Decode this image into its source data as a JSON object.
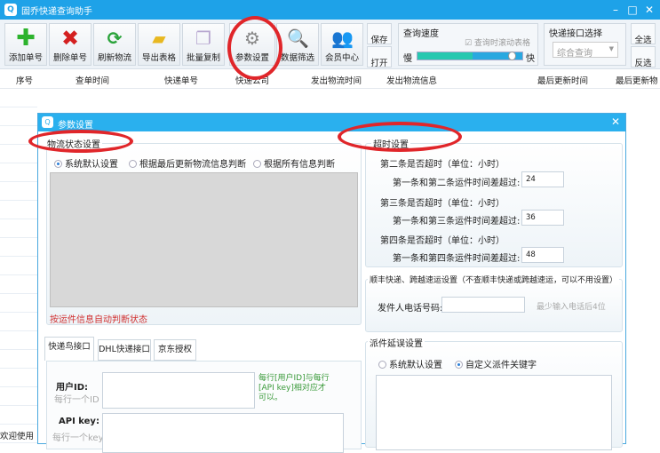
{
  "window": {
    "title": "固乔快递查询助手",
    "app_icon": "magnifier-icon"
  },
  "toolbar": {
    "buttons": [
      {
        "label": "添加单号",
        "icon": "plus-icon"
      },
      {
        "label": "删除单号",
        "icon": "x-icon"
      },
      {
        "label": "刷新物流",
        "icon": "refresh-icon"
      },
      {
        "label": "导出表格",
        "icon": "folder-icon"
      },
      {
        "label": "批量复制",
        "icon": "copy-icon"
      },
      {
        "label": "参数设置",
        "icon": "gear-icon"
      },
      {
        "label": "数据筛选",
        "icon": "search-folder-icon"
      },
      {
        "label": "会员中心",
        "icon": "users-icon"
      }
    ],
    "save": "保存",
    "open": "打开",
    "speed": {
      "title": "查询速度",
      "scroll_label": "查询时滚动表格",
      "slow": "慢",
      "fast": "快",
      "value_percent": 95
    },
    "interface": {
      "title": "快递接口选择",
      "selected": "综合查询"
    },
    "select_all": "全选",
    "invert": "反选"
  },
  "table": {
    "columns": [
      "序号",
      "查单时间",
      "快递单号",
      "快递公司",
      "发出物流时间",
      "发出物流信息",
      "最后更新时间",
      "最后更新物"
    ]
  },
  "status": "欢迎使用",
  "dialog": {
    "title": "参数设置",
    "logistics": {
      "title": "物流状态设置",
      "options": [
        "系统默认设置",
        "根据最后更新物流信息判断",
        "根据所有信息判断"
      ],
      "selected": 0,
      "note": "按运件信息自动判断状态"
    },
    "timeout": {
      "title": "超时设置",
      "rows": [
        {
          "head": "第二条是否超时（单位：小时）",
          "label": "第一条和第二条运件时间差超过:",
          "value": "24"
        },
        {
          "head": "第三条是否超时（单位：小时）",
          "label": "第一条和第三条运件时间差超过:",
          "value": "36"
        },
        {
          "head": "第四条是否超时（单位：小时）",
          "label": "第一条和第四条运件时间差超过:",
          "value": "48"
        }
      ]
    },
    "sf": {
      "title": "顺丰快递、跨越速运设置（不查顺丰快递或跨越速运，可以不用设置）",
      "phone_label": "发件人电话号码:",
      "phone_value": "",
      "hint": "最少输入电话后4位"
    },
    "delay": {
      "title": "派件延误设置",
      "options": [
        "系统默认设置",
        "自定义派件关键字"
      ],
      "selected": 1
    },
    "tabs": [
      "快递鸟接口",
      "DHL快递接口",
      "京东授权"
    ],
    "user_id_label": "用户ID:",
    "user_id_hint": "每行一个ID",
    "api_key_label": "API key:",
    "api_key_hint": "每行一个key",
    "pair_note": "每行[用户ID]与每行[API key]相对应才可以。"
  },
  "colors": {
    "titlebar": "#1ea2e8",
    "annotation": "#e0262a",
    "note_red": "#d03030",
    "note_green": "#3a9a3a"
  }
}
